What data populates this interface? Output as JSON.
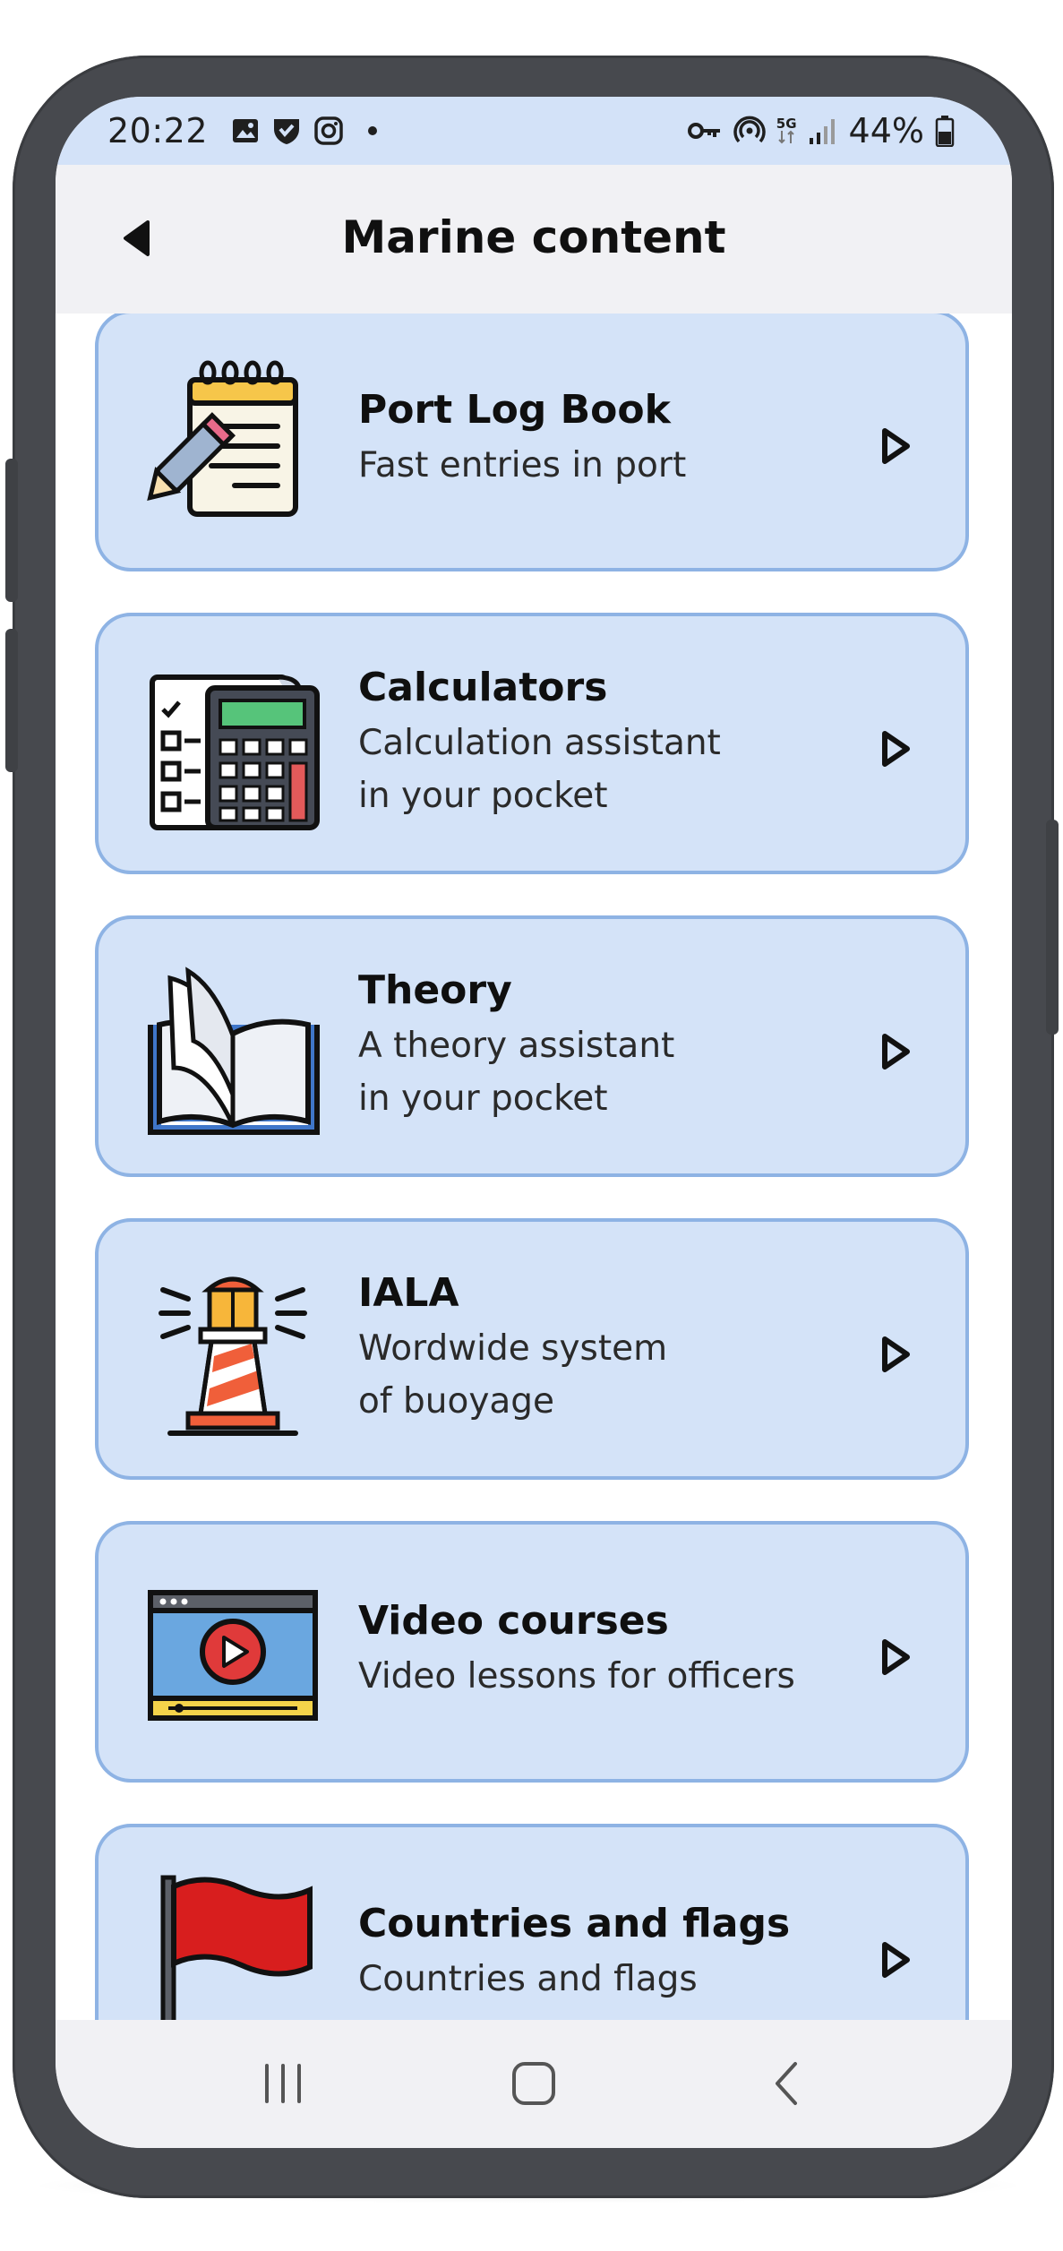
{
  "status_bar": {
    "time": "20:22",
    "battery": "44%",
    "network": "5G",
    "left_icons": [
      "gallery-icon",
      "shield-check-icon",
      "instagram-icon",
      "dot-icon"
    ],
    "right_icons": [
      "vpn-key-icon",
      "hotspot-icon",
      "5g-icon",
      "signal-icon",
      "battery-icon"
    ]
  },
  "header": {
    "title": "Marine content",
    "back_icon": "back-arrow-icon"
  },
  "cards": [
    {
      "title": "Port Log Book",
      "subtitle": [
        "Fast entries in port"
      ],
      "icon": "notepad-pencil-icon"
    },
    {
      "title": "Calculators",
      "subtitle": [
        "Calculation assistant",
        "in your pocket"
      ],
      "icon": "calculator-checklist-icon"
    },
    {
      "title": "Theory",
      "subtitle": [
        "A theory assistant",
        "in your pocket"
      ],
      "icon": "open-book-icon"
    },
    {
      "title": "IALA",
      "subtitle": [
        "Wordwide system",
        "of buoyage"
      ],
      "icon": "lighthouse-icon"
    },
    {
      "title": "Video courses",
      "subtitle": [
        "Video lessons for officers"
      ],
      "icon": "video-player-icon"
    },
    {
      "title": "Countries and flags",
      "subtitle": [
        "Countries and flags"
      ],
      "icon": "red-flag-icon"
    }
  ],
  "nav": {
    "recents_icon": "recents-icon",
    "home_icon": "home-icon",
    "back_icon": "nav-back-icon"
  },
  "colors": {
    "card_bg": "#d4e3f8",
    "card_border": "#8eb3e4",
    "status_bar_bg": "#d3e2f8",
    "phone_frame": "#47494e"
  }
}
